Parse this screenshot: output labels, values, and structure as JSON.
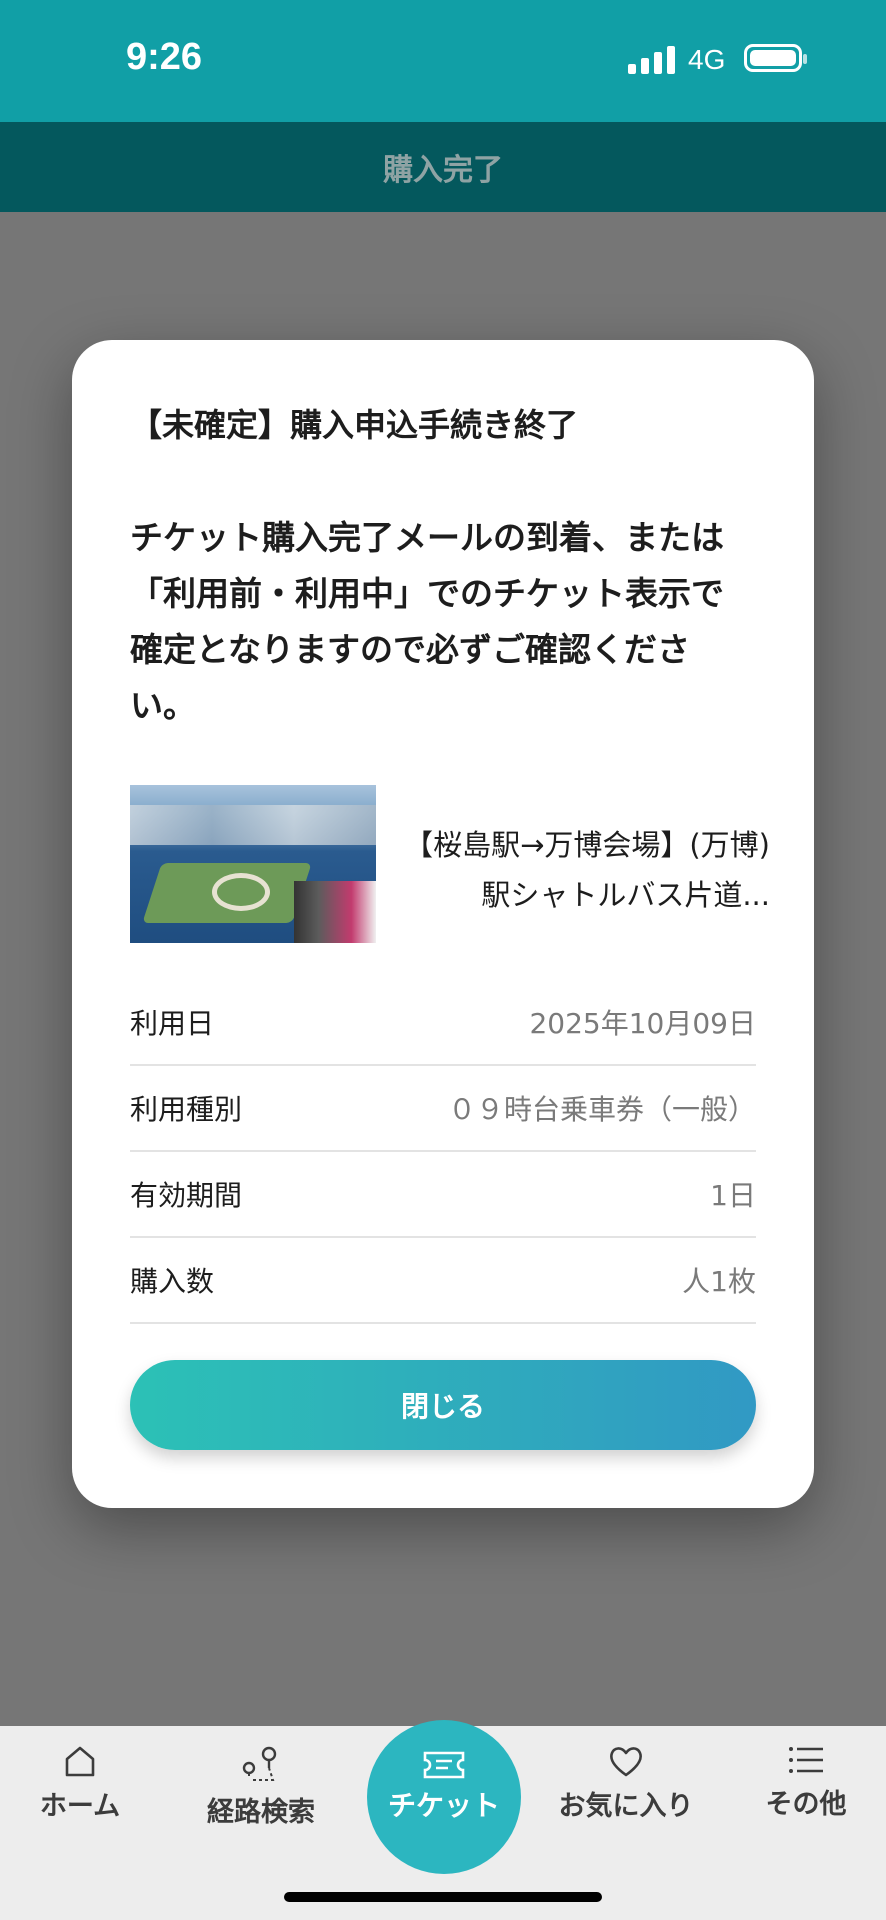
{
  "status_bar": {
    "time": "9:26",
    "network": "4G"
  },
  "header": {
    "title": "購入完了"
  },
  "modal": {
    "title": "【未確定】購入申込手続き終了",
    "message": "チケット購入完了メールの到着、または「利用前・利用中」でのチケット表示で確定となりますので必ずご確認ください。",
    "ticket_name": "【桜島駅→万博会場】(万博)駅シャトルバス片道...",
    "details": [
      {
        "label": "利用日",
        "value": "2025年10月09日"
      },
      {
        "label": "利用種別",
        "value": "０９時台乗車券（一般）"
      },
      {
        "label": "有効期間",
        "value": "1日"
      },
      {
        "label": "購入数",
        "value": "人1枚"
      }
    ],
    "close_label": "閉じる"
  },
  "tab_bar": {
    "items": [
      {
        "label": "ホーム",
        "icon": "home-icon"
      },
      {
        "label": "経路検索",
        "icon": "route-search-icon"
      },
      {
        "label": "チケット",
        "icon": "ticket-icon"
      },
      {
        "label": "お気に入り",
        "icon": "heart-icon"
      },
      {
        "label": "その他",
        "icon": "menu-list-icon"
      }
    ]
  },
  "colors": {
    "status_bar": "#119fa6",
    "header": "#04585d",
    "overlay": "#767676",
    "button_start": "#2cc1b6",
    "button_end": "#3199c4",
    "tab_active": "#2cb6c0"
  }
}
